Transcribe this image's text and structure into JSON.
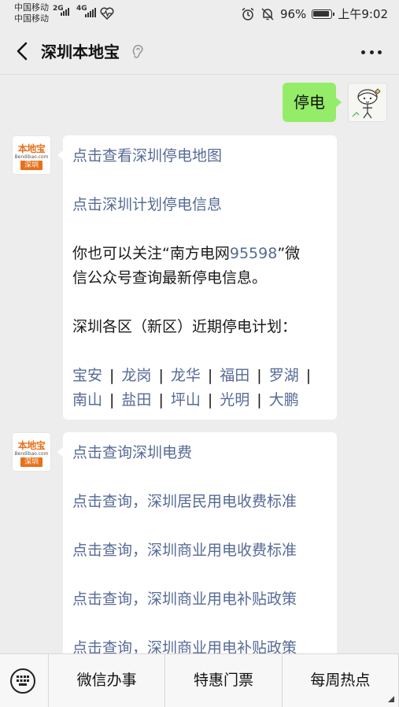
{
  "status_bar": {
    "carrier1": "中国移动",
    "carrier2": "中国移动",
    "net1": "2G",
    "net2": "4G",
    "battery_percent": "96%",
    "time": "上午9:02"
  },
  "header": {
    "title": "深圳本地宝"
  },
  "avatar_bot": {
    "brand": "本地宝",
    "site": "Bendibao.com",
    "city": "深圳"
  },
  "messages": {
    "user_text": "停电",
    "reply1": {
      "link1": "点击查看深圳停电地图",
      "link2": "点击深圳计划停电信息",
      "text1": "你也可以关注“南方电网",
      "hotline": "95598",
      "text2": "”微",
      "text3": "信公众号查询最新停电信息。",
      "text4": "深圳各区（新区）近期停电计划：",
      "districts_row1": [
        "宝安",
        "龙岗",
        "龙华",
        "福田",
        "罗湖"
      ],
      "districts_row2": [
        "南山",
        "盐田",
        "坪山",
        "光明",
        "大鹏"
      ]
    },
    "reply2": {
      "links": [
        "点击查询深圳电费",
        "点击查询，深圳居民用电收费标准",
        "点击查询，深圳商业用电收费标准",
        "点击查询，深圳商业用电补贴政策",
        "点击查询，深圳商业用电补贴政策"
      ]
    }
  },
  "menu": {
    "item1": "微信办事",
    "item2": "特惠门票",
    "item3": "每周热点"
  },
  "colors": {
    "link": "#576b95",
    "user_bubble": "#95ec69",
    "background": "#ededed",
    "brand": "#e8701a"
  }
}
